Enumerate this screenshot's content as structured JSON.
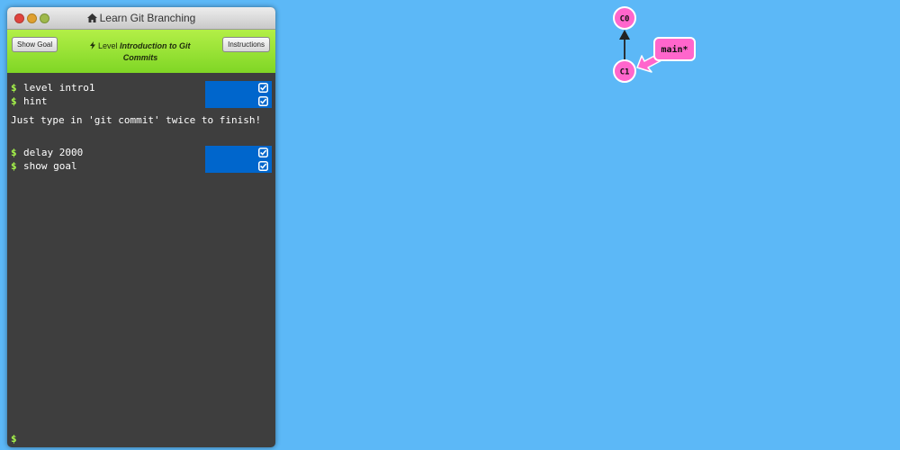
{
  "window": {
    "title": "Learn Git Branching"
  },
  "level_bar": {
    "show_goal_label": "Show Goal",
    "level_prefix": "Level",
    "level_name": "Introduction to Git Commits",
    "instructions_label": "Instructions"
  },
  "console": {
    "prompt_symbol": "$",
    "commands": [
      {
        "text": "level intro1",
        "done": true
      },
      {
        "text": "hint",
        "done": true
      },
      {
        "text": "delay 2000",
        "done": true
      },
      {
        "text": "show goal",
        "done": true
      }
    ],
    "hint_message": "Just type in 'git commit' twice to finish!"
  },
  "graph": {
    "commits": [
      {
        "id": "C0",
        "parent": null
      },
      {
        "id": "C1",
        "parent": "C0"
      }
    ],
    "branch": {
      "name": "main*",
      "points_to": "C1"
    },
    "colors": {
      "commit_fill": "#ff66cc",
      "commit_stroke": "#ffffff",
      "branch_fill": "#ff66cc",
      "edge": "#222222"
    }
  },
  "colors": {
    "background": "#5cb8f7",
    "terminal_bg": "#3e3e3e",
    "level_bar": "#97e138",
    "command_done_bg": "#0066cc",
    "prompt": "#a6f54a"
  },
  "icons": {
    "home": "home-icon",
    "lightning": "lightning-icon",
    "check": "checkbox-checked-icon"
  }
}
